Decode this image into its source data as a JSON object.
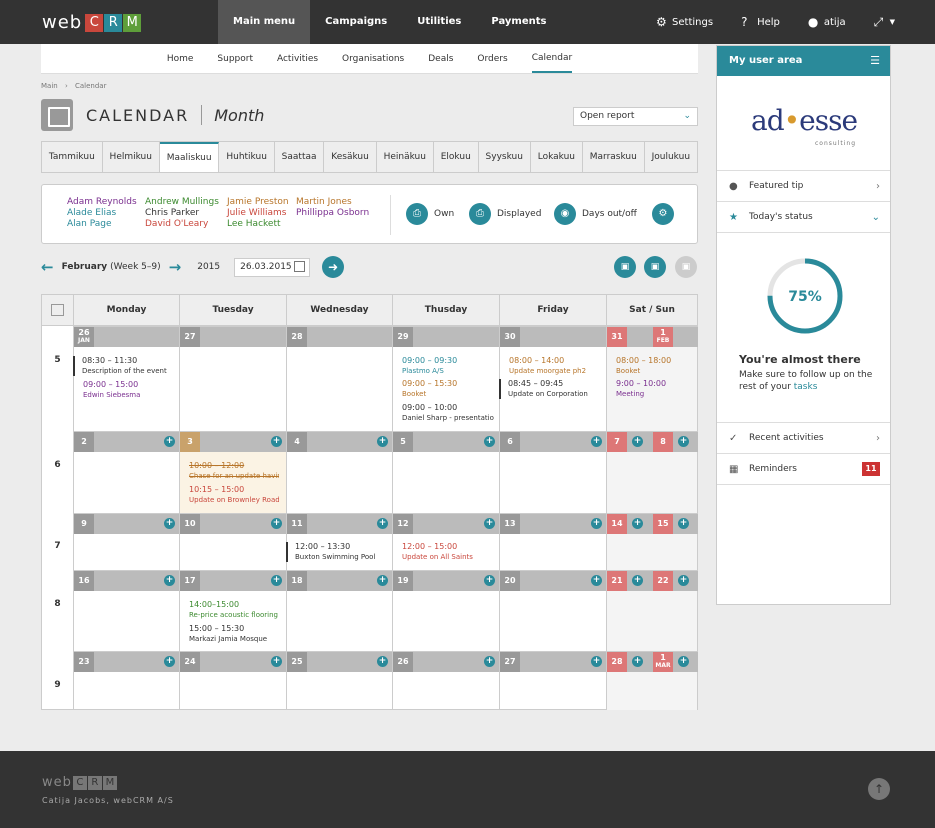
{
  "topbar": {
    "logo_text": "web",
    "logo_boxes": [
      {
        "char": "C",
        "color": "#c9473c"
      },
      {
        "char": "R",
        "color": "#2a8a9a"
      },
      {
        "char": "M",
        "color": "#5e9e3a"
      }
    ],
    "nav": [
      "Main menu",
      "Campaigns",
      "Utilities",
      "Payments"
    ],
    "settings": "Settings",
    "help": "Help",
    "user": "atija"
  },
  "subnav": [
    "Home",
    "Support",
    "Activities",
    "Organisations",
    "Deals",
    "Orders",
    "Calendar"
  ],
  "breadcrumb": {
    "root": "Main",
    "sep": "›",
    "current": "Calendar"
  },
  "page": {
    "title": "CALENDAR",
    "subtitle": "Month",
    "report": "Open report"
  },
  "months": [
    "Tammikuu",
    "Helmikuu",
    "Maaliskuu",
    "Huhtikuu",
    "Saattaa",
    "Kesäkuu",
    "Heinäkuu",
    "Elokuu",
    "Syyskuu",
    "Lokakuu",
    "Marraskuu",
    "Joulukuu"
  ],
  "users": {
    "col1": [
      "Adam Reynolds",
      "Alade Elias",
      "Alan Page"
    ],
    "col2": [
      "Andrew Mullings",
      "Chris Parker",
      "David O'Leary"
    ],
    "col3": [
      "Jamie Preston",
      "Julie Williams",
      "Lee Hackett"
    ],
    "col4": [
      "Martin Jones",
      "Phillippa Osborn"
    ],
    "opt_own": "Own",
    "opt_displayed": "Displayed",
    "opt_days": "Days out/off"
  },
  "weeknav": {
    "month": "February",
    "week": "(Week 5–9)",
    "year": "2015",
    "date": "26.03.2015"
  },
  "grid": {
    "headers": [
      "Monday",
      "Tuesday",
      "Wednesday",
      "Thusday",
      "Friday",
      "Sat / Sun"
    ],
    "weeks": [
      "5",
      "6",
      "7",
      "8",
      "9"
    ],
    "rows": [
      {
        "days": [
          {
            "n": "26",
            "m": "JAN"
          },
          {
            "n": "27"
          },
          {
            "n": "28"
          },
          {
            "n": "29"
          },
          {
            "n": "30"
          },
          {
            "n": "31",
            "we": true
          },
          {
            "n": "1",
            "m": "FEB",
            "we": true
          }
        ]
      },
      {
        "days": [
          {
            "n": "2"
          },
          {
            "n": "3",
            "today": true
          },
          {
            "n": "4"
          },
          {
            "n": "5"
          },
          {
            "n": "6"
          },
          {
            "n": "7",
            "we": true
          },
          {
            "n": "8",
            "we": true
          }
        ]
      },
      {
        "days": [
          {
            "n": "9"
          },
          {
            "n": "10"
          },
          {
            "n": "11"
          },
          {
            "n": "12"
          },
          {
            "n": "13"
          },
          {
            "n": "14",
            "we": true
          },
          {
            "n": "15",
            "we": true
          }
        ]
      },
      {
        "days": [
          {
            "n": "16"
          },
          {
            "n": "17"
          },
          {
            "n": "18"
          },
          {
            "n": "19"
          },
          {
            "n": "20"
          },
          {
            "n": "21",
            "we": true
          },
          {
            "n": "22",
            "we": true
          }
        ]
      },
      {
        "days": [
          {
            "n": "23"
          },
          {
            "n": "24"
          },
          {
            "n": "25"
          },
          {
            "n": "26"
          },
          {
            "n": "27"
          },
          {
            "n": "28",
            "we": true
          },
          {
            "n": "1",
            "m": "MAR",
            "we": true
          }
        ]
      }
    ],
    "events": {
      "w5_mon_1_t": "08:30 – 11:30",
      "w5_mon_1_d": "Description of the event",
      "w5_mon_2_t": "09:00 – 15:00",
      "w5_mon_2_d": "Edwin Siebesma",
      "w5_thu_1_t": "09:00 – 09:30",
      "w5_thu_1_d": "Plastmo A/S",
      "w5_thu_2_t": "09:00 – 15:30",
      "w5_thu_2_d": "Booket",
      "w5_thu_3_t": "09:00 – 10:00",
      "w5_thu_3_d": "Daniel Sharp - presentation",
      "w5_fri_1_t": "08:00 – 14:00",
      "w5_fri_1_d": "Update moorgate ph2",
      "w5_fri_2_t": "08:45 – 09:45",
      "w5_fri_2_d": "Update on Corporation",
      "w5_sat_1_t": "08:00 – 18:00",
      "w5_sat_1_d": "Booket",
      "w5_sat_2_t": "9:00 – 10:00",
      "w5_sat_2_d": "Meeting",
      "w6_tue_1_t": "10:00 – 12:00",
      "w6_tue_1_d": "Chase for an update having",
      "w6_tue_2_t": "10:15 – 15:00",
      "w6_tue_2_d": "Update on Brownley Road",
      "w7_wed_1_t": "12:00 – 13:30",
      "w7_wed_1_d": "Buxton Swimming Pool",
      "w7_thu_1_t": "12:00 – 15:00",
      "w7_thu_1_d": "Update on All Saints",
      "w8_tue_1_t": "14:00–15:00",
      "w8_tue_1_d": "Re-price acoustic flooring",
      "w8_tue_2_t": "15:00 – 15:30",
      "w8_tue_2_d": "Markazi Jamia Mosque"
    }
  },
  "side": {
    "title": "My user area",
    "logo_a": "ad",
    "logo_dot": "•",
    "logo_b": "esse",
    "logo_sub": "consulting",
    "featured": "Featured tip",
    "status": "Today's status",
    "progress_value": 0.75,
    "progress_label": "75%",
    "almost": "You're almost there",
    "follow_pre": "Make sure to follow up on the rest of your",
    "follow_link": "tasks",
    "recent": "Recent activities",
    "reminders": "Reminders",
    "reminders_count": "11"
  },
  "footer": {
    "logo_text": "web",
    "logo_boxes": [
      "C",
      "R",
      "M"
    ],
    "text": "Catija Jacobs,  webCRM A/S"
  },
  "colors": {
    "accent": "#2a8a9a",
    "weekend": "#d77777",
    "today": "#c9a26b",
    "event_brown": "#b7752a",
    "event_purple": "#7a2f8f",
    "event_teal": "#2a8a9a",
    "event_green": "#3c8a2f",
    "event_red": "#c9473c"
  }
}
